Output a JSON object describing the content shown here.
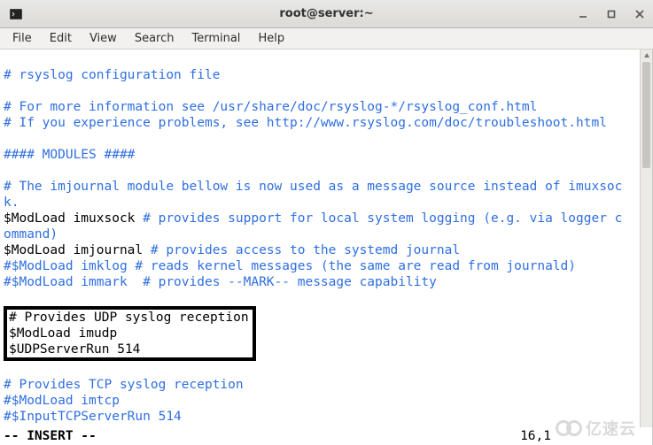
{
  "window": {
    "title": "root@server:~"
  },
  "menu": {
    "file": "File",
    "edit": "Edit",
    "view": "View",
    "search": "Search",
    "terminal": "Terminal",
    "help": "Help"
  },
  "file": {
    "l1": "# rsyslog configuration file",
    "l2": "",
    "l3": "# For more information see /usr/share/doc/rsyslog-*/rsyslog_conf.html",
    "l4": "# If you experience problems, see http://www.rsyslog.com/doc/troubleshoot.html",
    "l5": "",
    "l6": "#### MODULES ####",
    "l7": "",
    "l8a": "# The imjournal module bellow is now used as a message source instead of imuxsoc",
    "l8b": "k.",
    "l9a": "$ModLoad imuxsock ",
    "l9b": "# provides support for local system logging (e.g. via logger c",
    "l9c": "ommand)",
    "l10a": "$ModLoad imjournal ",
    "l10b": "# provides access to the systemd journal",
    "l11": "#$ModLoad imklog # reads kernel messages (the same are read from journald)",
    "l12": "#$ModLoad immark  # provides --MARK-- message capability",
    "l13": "",
    "l14": "# Provides UDP syslog reception",
    "l15": "$ModLoad imudp",
    "l16": "$UDPServerRun 514",
    "l17": "",
    "l18": "# Provides TCP syslog reception",
    "l19": "#$ModLoad imtcp",
    "l20": "#$InputTCPServerRun 514"
  },
  "status": {
    "mode": "-- INSERT --",
    "pos": "16,1"
  },
  "watermark": "亿速云"
}
